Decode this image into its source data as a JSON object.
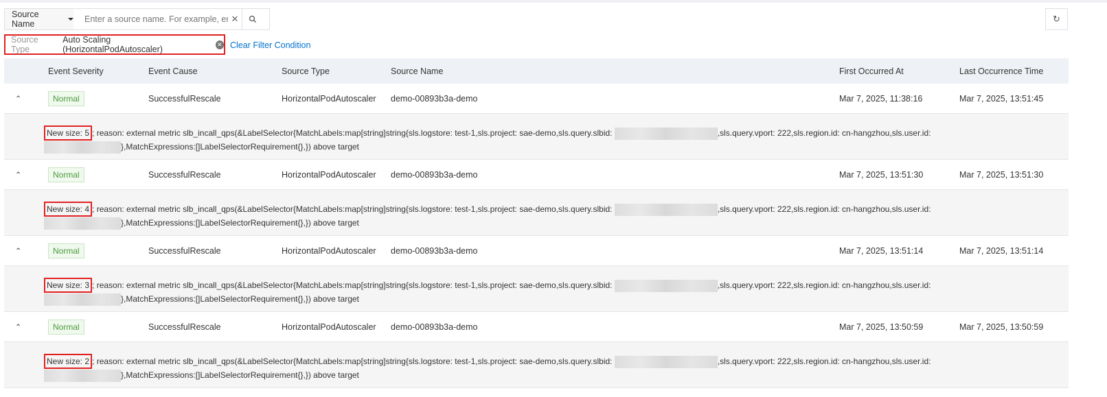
{
  "search": {
    "selector_label": "Source Name",
    "placeholder": "Enter a source name. For example, enter an"
  },
  "filter": {
    "key": "Source Type",
    "value": "Auto Scaling (HorizontalPodAutoscaler)",
    "clear_label": "Clear Filter Condition"
  },
  "table": {
    "headers": [
      "Event Severity",
      "Event Cause",
      "Source Type",
      "Source Name",
      "First Occurred At",
      "Last Occurrence Time"
    ],
    "rows": [
      {
        "severity": "Normal",
        "cause": "SuccessfulRescale",
        "type": "HorizontalPodAutoscaler",
        "name": "demo-00893b3a-demo",
        "first": "Mar 7, 2025, 11:38:16",
        "last": "Mar 7, 2025, 13:51:45",
        "new_size": "New size: 5",
        "msg_a": "; reason: external metric slb_incall_qps(&LabelSelector{MatchLabels:map[string]string{sls.logstore: test-1,sls.project: sae-demo,sls.query.slbid: ",
        "msg_b": ",sls.query.vport: 222,sls.region.id: cn-hangzhou,sls.user.id:",
        "msg_c": "},MatchExpressions:[]LabelSelectorRequirement{},}) above target"
      },
      {
        "severity": "Normal",
        "cause": "SuccessfulRescale",
        "type": "HorizontalPodAutoscaler",
        "name": "demo-00893b3a-demo",
        "first": "Mar 7, 2025, 13:51:30",
        "last": "Mar 7, 2025, 13:51:30",
        "new_size": "New size: 4",
        "msg_a": "; reason: external metric slb_incall_qps(&LabelSelector{MatchLabels:map[string]string{sls.logstore: test-1,sls.project: sae-demo,sls.query.slbid: ",
        "msg_b": ",sls.query.vport: 222,sls.region.id: cn-hangzhou,sls.user.id:",
        "msg_c": "},MatchExpressions:[]LabelSelectorRequirement{},}) above target"
      },
      {
        "severity": "Normal",
        "cause": "SuccessfulRescale",
        "type": "HorizontalPodAutoscaler",
        "name": "demo-00893b3a-demo",
        "first": "Mar 7, 2025, 13:51:14",
        "last": "Mar 7, 2025, 13:51:14",
        "new_size": "New size: 3",
        "msg_a": "; reason: external metric slb_incall_qps(&LabelSelector{MatchLabels:map[string]string{sls.logstore: test-1,sls.project: sae-demo,sls.query.slbid: ",
        "msg_b": ",sls.query.vport: 222,sls.region.id: cn-hangzhou,sls.user.id:",
        "msg_c": "},MatchExpressions:[]LabelSelectorRequirement{},}) above target"
      },
      {
        "severity": "Normal",
        "cause": "SuccessfulRescale",
        "type": "HorizontalPodAutoscaler",
        "name": "demo-00893b3a-demo",
        "first": "Mar 7, 2025, 13:50:59",
        "last": "Mar 7, 2025, 13:50:59",
        "new_size": "New size: 2",
        "msg_a": "; reason: external metric slb_incall_qps(&LabelSelector{MatchLabels:map[string]string{sls.logstore: test-1,sls.project: sae-demo,sls.query.slbid: ",
        "msg_b": ",sls.query.vport: 222,sls.region.id: cn-hangzhou,sls.user.id:",
        "msg_c": "},MatchExpressions:[]LabelSelectorRequirement{},}) above target"
      }
    ]
  }
}
